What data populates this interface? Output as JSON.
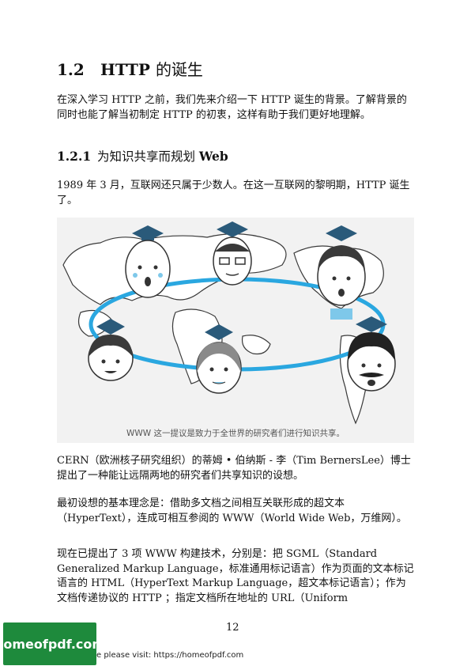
{
  "heading": {
    "number": "1.2",
    "title_en": "HTTP",
    "title_zh": "的诞生"
  },
  "intro": "在深入学习 HTTP 之前，我们先来介绍一下 HTTP 诞生的背景。了解背景的同时也能了解当初制定 HTTP 的初衷，这样有助于我们更好地理解。",
  "subheading": {
    "number": "1.2.1",
    "title_zh": "为知识共享而规划",
    "title_en": "Web"
  },
  "para1": "1989 年 3 月，互联网还只属于少数人。在这一互联网的黎明期，HTTP 诞生了。",
  "figure": {
    "caption": "WWW 这一提议是致力于全世界的研究者们进行知识共享。"
  },
  "para2": "CERN（欧洲核子研究组织）的蒂姆 • 伯纳斯 - 李（Tim BernersLee）博士提出了一种能让远隔两地的研究者们共享知识的设想。",
  "para3": "最初设想的基本理念是：借助多文档之间相互关联形成的超文本（HyperText），连成可相互参阅的 WWW（World Wide Web，万维网）。",
  "para4": "现在已提出了 3 项 WWW 构建技术，分别是：把 SGML（Standard Generalized Markup Language，标准通用标记语言）作为页面的文本标记语言的 HTML（HyperText Markup Language，超文本标记语言）；作为文档传递协议的 HTTP ；指定文档所在地址的 URL（Uniform",
  "page_number": "12",
  "watermark": {
    "logo_text": "homeofpdf.com",
    "footer_text": "e please visit: https://homeofpdf.com"
  },
  "colors": {
    "ring": "#2aa7e0",
    "map": "#ffffff",
    "cap": "#2a5a7a",
    "logo_bg": "#1e8a3c"
  }
}
